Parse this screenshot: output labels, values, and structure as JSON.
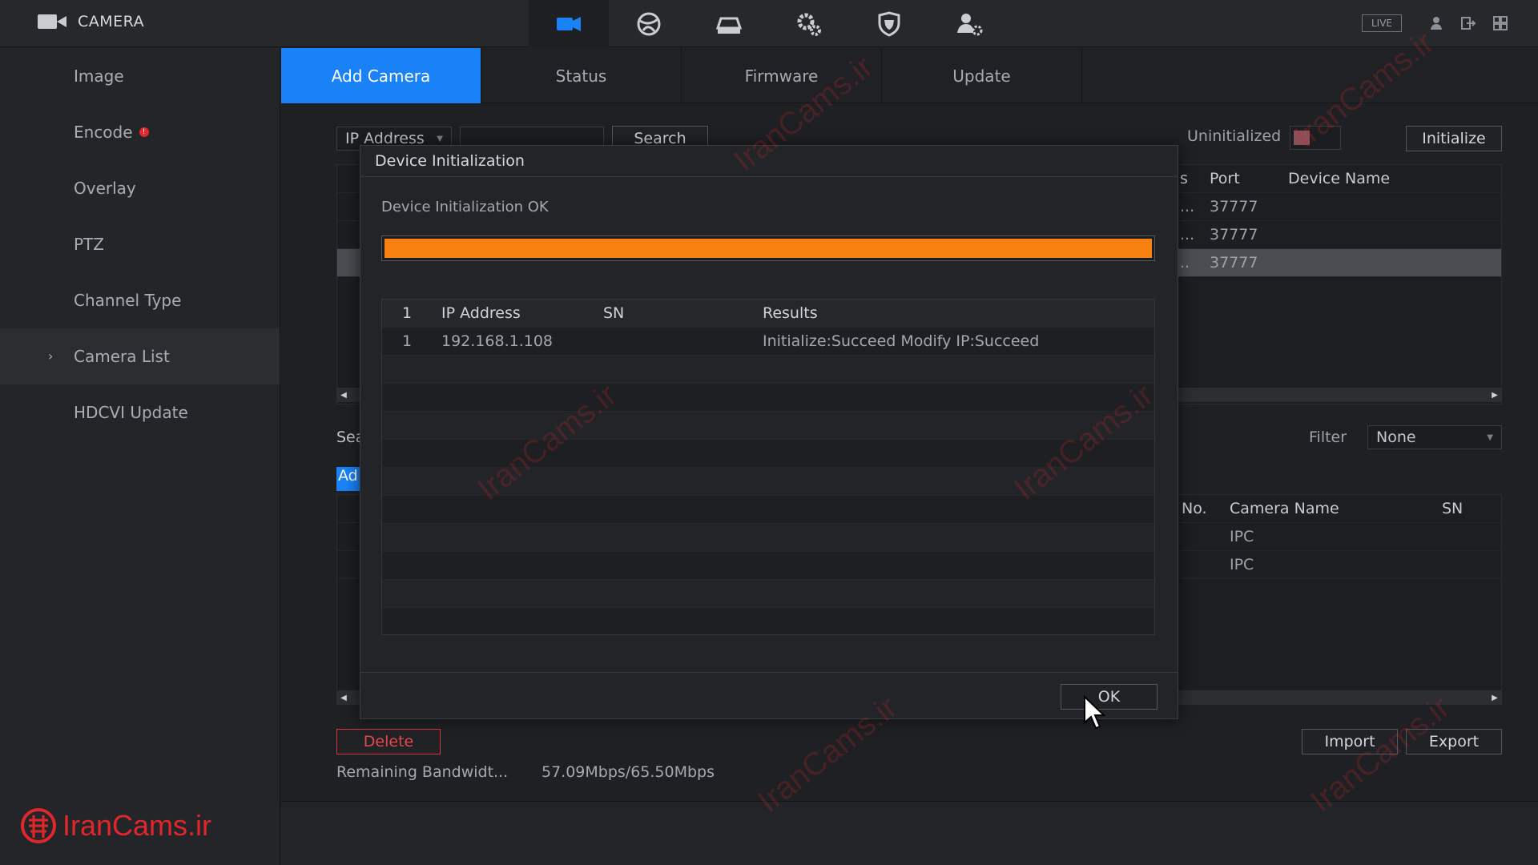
{
  "header": {
    "app_title": "CAMERA",
    "live_label": "LIVE",
    "nav_icons": [
      "camera-icon",
      "network-globe-icon",
      "storage-icon",
      "system-gears-icon",
      "security-shield-icon",
      "account-icon"
    ],
    "right_icons": [
      "user-icon",
      "logout-icon",
      "grid-icon"
    ],
    "accent": "#1a82f7"
  },
  "sidebar": {
    "items": [
      {
        "label": "Image"
      },
      {
        "label": "Encode",
        "badge": "!"
      },
      {
        "label": "Overlay"
      },
      {
        "label": "PTZ"
      },
      {
        "label": "Channel Type"
      },
      {
        "label": "Camera List",
        "active": true
      },
      {
        "label": "HDCVI Update"
      }
    ]
  },
  "logo": {
    "text": "IranCams.ir",
    "color": "#e1262c"
  },
  "tabs": [
    "Add Camera",
    "Status",
    "Firmware",
    "Update"
  ],
  "search": {
    "filter_type": "IP Address",
    "search_label": "Search",
    "uninitialized_label": "Uninitialized",
    "initialize_label": "Initialize"
  },
  "device_table": {
    "columns": [
      "s",
      "Port",
      "Device Name"
    ],
    "rows": [
      {
        "s": "...",
        "port": "37777"
      },
      {
        "s": "...",
        "port": "37777"
      },
      {
        "s": "..",
        "port": "37777"
      }
    ]
  },
  "added_section": {
    "search_prefix": "Sea",
    "add_prefix": "Ad",
    "filter_label": "Filter",
    "filter_value": "None",
    "columns": [
      "No.",
      "Camera Name",
      "SN"
    ],
    "rows": [
      {
        "name": "IPC"
      },
      {
        "name": "IPC"
      }
    ]
  },
  "footer": {
    "delete_label": "Delete",
    "import_label": "Import",
    "export_label": "Export",
    "bandwidth_label": "Remaining Bandwidt...",
    "bandwidth_value": "57.09Mbps/65.50Mbps"
  },
  "modal": {
    "title": "Device Initialization",
    "status": "Device Initialization OK",
    "progress": 1.0,
    "progress_color": "#f78210",
    "columns": {
      "index": "1",
      "ip": "IP Address",
      "sn": "SN",
      "results": "Results"
    },
    "rows": [
      {
        "index": "1",
        "ip": "192.168.1.108",
        "sn": "",
        "results": "Initialize:Succeed Modify IP:Succeed"
      }
    ],
    "ok_label": "OK"
  },
  "watermark_text": "IranCams.ir"
}
